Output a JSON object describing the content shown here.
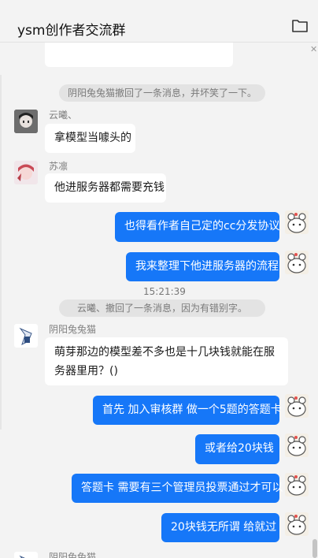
{
  "window": {
    "title": "ysm创作者交流群"
  },
  "icons": {
    "folder": "folder-icon",
    "close": "close-icon"
  },
  "colors": {
    "outgoing_bubble": "#1677f8",
    "incoming_bubble": "#ffffff",
    "background": "#f3f3f3"
  },
  "messages": {
    "system_1": "阴阳兔兔猫撤回了一条消息，并坏笑了一下。",
    "m1_sender": "云曦、",
    "m1_text": "拿模型当噱头的",
    "m2_sender": "苏凛",
    "m2_text": "他进服务器都需要充钱",
    "o1_text": "也得看作者自己定的cc分发协议",
    "o2_text": "我来整理下他进服务器的流程",
    "time_1": "15:21:39",
    "system_2": "云曦、撤回了一条消息，因为有错别字。",
    "m3_sender": "阴阳兔兔猫",
    "m3_text": "萌芽那边的模型差不多也是十几块钱就能在服务器里用？()",
    "o3_text": "首先 加入审核群 做一个5题的答题卡",
    "o4_text": "或者给20块钱",
    "o5_text": "答题卡 需要有三个管理员投票通过才可以",
    "o6_text": "20块钱无所谓 给就过",
    "m4_sender": "阴阳兔兔猫"
  }
}
